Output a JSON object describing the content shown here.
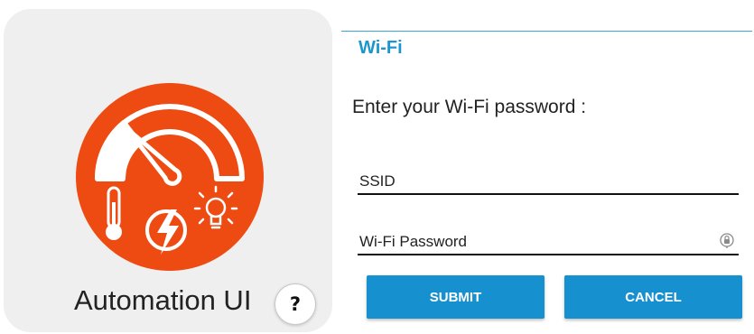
{
  "app": {
    "name": "Automation UI",
    "help_label": "?",
    "icons": [
      "gauge-icon",
      "thermometer-icon",
      "lightning-icon",
      "lightbulb-icon"
    ],
    "accent_color": "#ee4b12"
  },
  "wifi": {
    "title": "Wi-Fi",
    "prompt": "Enter your Wi-Fi password :",
    "ssid_placeholder": "SSID",
    "password_placeholder": "Wi-Fi Password",
    "password_toggle_icon": "lock-icon",
    "submit_label": "SUBMIT",
    "cancel_label": "CANCEL",
    "accent_color": "#1790cf"
  }
}
